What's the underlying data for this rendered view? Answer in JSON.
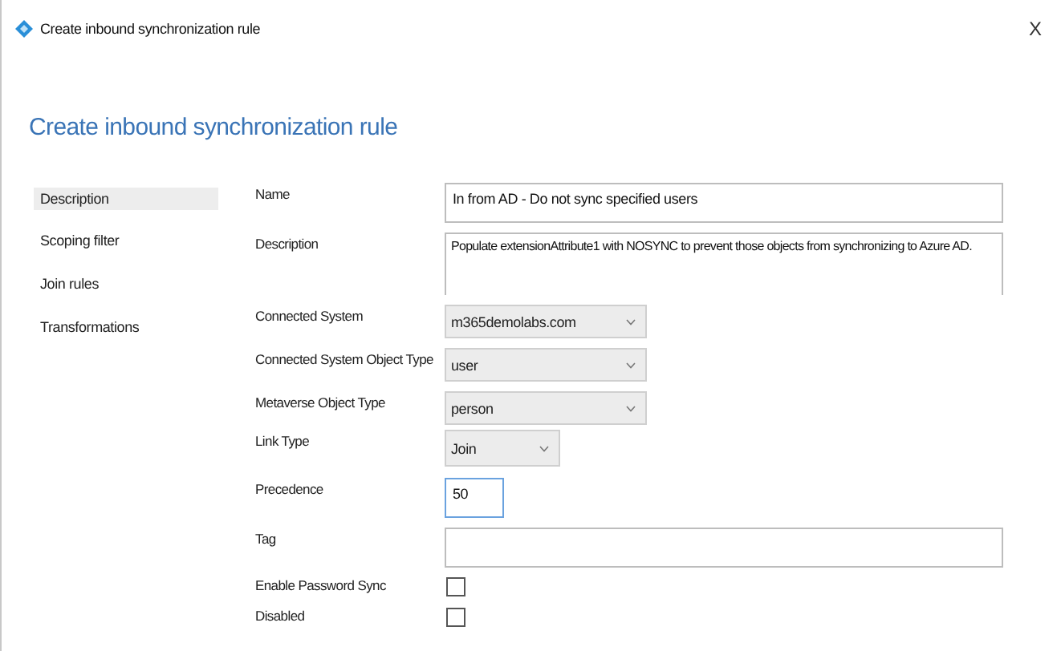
{
  "window": {
    "title": "Create inbound synchronization rule",
    "close": "X"
  },
  "heading": "Create inbound synchronization rule",
  "sidebar": {
    "items": [
      {
        "label": "Description",
        "selected": true
      },
      {
        "label": "Scoping filter",
        "selected": false
      },
      {
        "label": "Join rules",
        "selected": false
      },
      {
        "label": "Transformations",
        "selected": false
      }
    ]
  },
  "fields": [
    {
      "kind": "text",
      "label": "Name",
      "value": "In from AD - Do not sync specified users",
      "focused": false
    },
    {
      "kind": "textarea",
      "label": "Description",
      "value": "Populate extensionAttribute1 with NOSYNC to prevent those objects from synchronizing to Azure AD."
    },
    {
      "kind": "dropdown",
      "label": "Connected System",
      "value": "m365demolabs.com"
    },
    {
      "kind": "dropdown",
      "label": "Connected System Object Type",
      "value": "user"
    },
    {
      "kind": "dropdown",
      "label": "Metaverse Object Type",
      "value": "person"
    },
    {
      "kind": "short-dropdown",
      "label": "Link Type",
      "value": "Join"
    },
    {
      "kind": "short-text",
      "label": "Precedence",
      "value": "50",
      "focused": true
    },
    {
      "kind": "text",
      "label": "Tag",
      "focused": false
    },
    {
      "kind": "checkbox",
      "label": "Enable Password Sync",
      "checked": false
    },
    {
      "kind": "checkbox",
      "label": "Disabled",
      "checked": false
    }
  ]
}
